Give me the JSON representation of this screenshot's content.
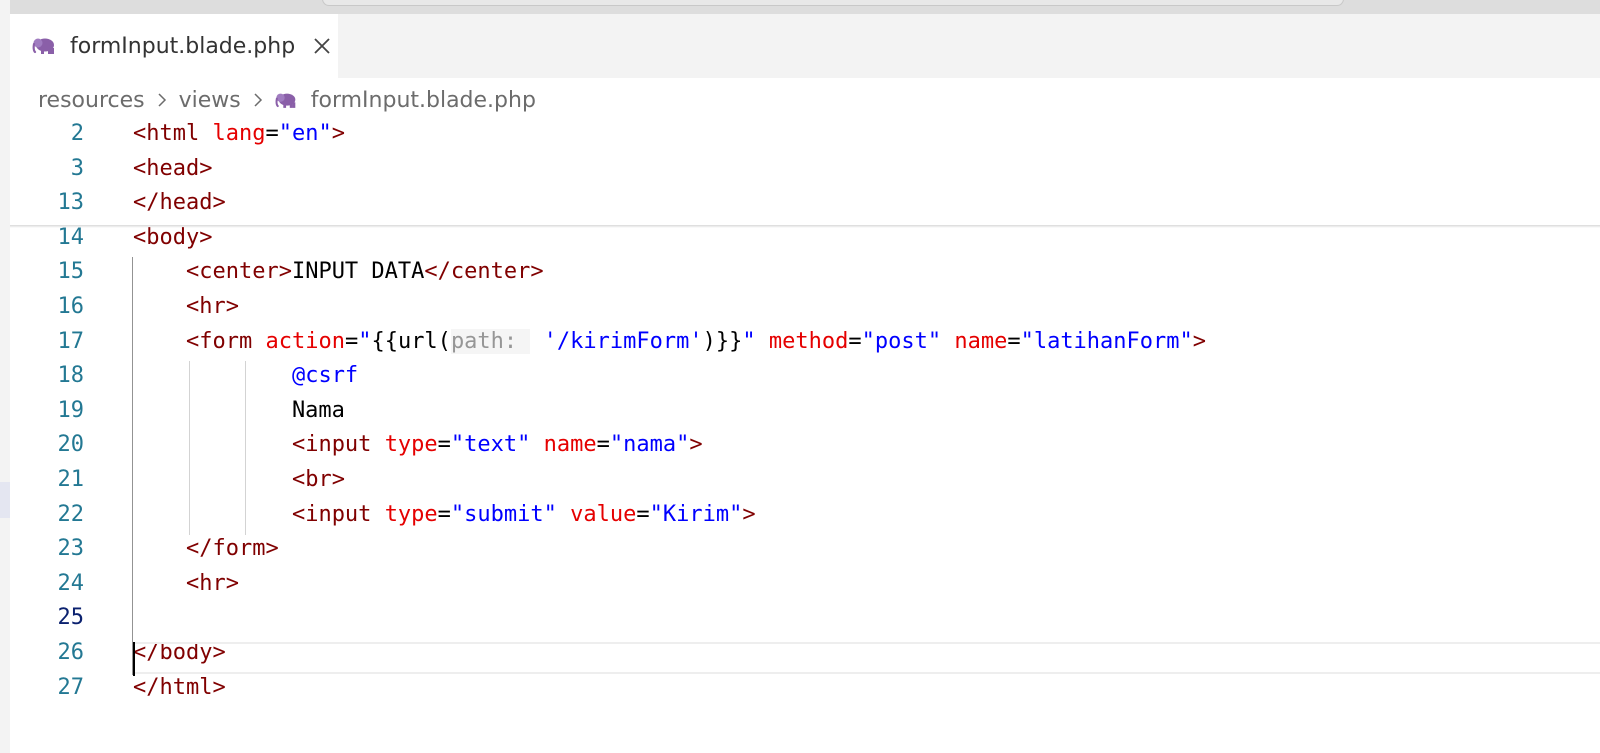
{
  "tab": {
    "label": "formInput.blade.php",
    "icon": "php-elephant-icon"
  },
  "breadcrumb": {
    "items": [
      "resources",
      "views"
    ],
    "file": "formInput.blade.php"
  },
  "colors": {
    "tag": "#800000",
    "attribute": "#e50000",
    "string": "#0000ff",
    "line_number": "#237893",
    "inlay_hint": "#969696"
  },
  "code": {
    "current_line": 25,
    "lines": [
      {
        "n": "2",
        "tokens": [
          [
            "t",
            "<html"
          ],
          [
            "d",
            " "
          ],
          [
            "a",
            "lang"
          ],
          [
            "d",
            "="
          ],
          [
            "s",
            "\"en\""
          ],
          [
            "t",
            ">"
          ]
        ]
      },
      {
        "n": "3",
        "tokens": [
          [
            "t",
            "<head>"
          ]
        ]
      },
      {
        "n": "13",
        "tokens": [
          [
            "t",
            "</head>"
          ]
        ]
      },
      {
        "n": "14",
        "tokens": [
          [
            "t",
            "<body>"
          ]
        ]
      },
      {
        "n": "15",
        "tokens": [
          [
            "d",
            "    "
          ],
          [
            "t",
            "<center>"
          ],
          [
            "d",
            "INPUT DATA"
          ],
          [
            "t",
            "</center>"
          ]
        ]
      },
      {
        "n": "16",
        "tokens": [
          [
            "d",
            "    "
          ],
          [
            "t",
            "<hr>"
          ]
        ]
      },
      {
        "n": "17",
        "tokens": [
          [
            "d",
            "    "
          ],
          [
            "t",
            "<form"
          ],
          [
            "d",
            " "
          ],
          [
            "a",
            "action"
          ],
          [
            "d",
            "="
          ],
          [
            "s",
            "\""
          ],
          [
            "d",
            "{{url("
          ],
          [
            "hint",
            "path: "
          ],
          [
            "d",
            " "
          ],
          [
            "s",
            "'/kirimForm'"
          ],
          [
            "d",
            ")}}"
          ],
          [
            "s",
            "\""
          ],
          [
            "d",
            " "
          ],
          [
            "a",
            "method"
          ],
          [
            "d",
            "="
          ],
          [
            "s",
            "\"post\""
          ],
          [
            "d",
            " "
          ],
          [
            "a",
            "name"
          ],
          [
            "d",
            "="
          ],
          [
            "s",
            "\"latihanForm\""
          ],
          [
            "t",
            ">"
          ]
        ]
      },
      {
        "n": "18",
        "tokens": [
          [
            "d",
            "            "
          ],
          [
            "s",
            "@csrf"
          ]
        ]
      },
      {
        "n": "19",
        "tokens": [
          [
            "d",
            "            Nama"
          ]
        ]
      },
      {
        "n": "20",
        "tokens": [
          [
            "d",
            "            "
          ],
          [
            "t",
            "<input"
          ],
          [
            "d",
            " "
          ],
          [
            "a",
            "type"
          ],
          [
            "d",
            "="
          ],
          [
            "s",
            "\"text\""
          ],
          [
            "d",
            " "
          ],
          [
            "a",
            "name"
          ],
          [
            "d",
            "="
          ],
          [
            "s",
            "\"nama\""
          ],
          [
            "t",
            ">"
          ]
        ]
      },
      {
        "n": "21",
        "tokens": [
          [
            "d",
            "            "
          ],
          [
            "t",
            "<br>"
          ]
        ]
      },
      {
        "n": "22",
        "tokens": [
          [
            "d",
            "            "
          ],
          [
            "t",
            "<input"
          ],
          [
            "d",
            " "
          ],
          [
            "a",
            "type"
          ],
          [
            "d",
            "="
          ],
          [
            "s",
            "\"submit\""
          ],
          [
            "d",
            " "
          ],
          [
            "a",
            "value"
          ],
          [
            "d",
            "="
          ],
          [
            "s",
            "\"Kirim\""
          ],
          [
            "t",
            ">"
          ]
        ]
      },
      {
        "n": "23",
        "tokens": [
          [
            "d",
            "    "
          ],
          [
            "t",
            "</form>"
          ]
        ]
      },
      {
        "n": "24",
        "tokens": [
          [
            "d",
            "    "
          ],
          [
            "t",
            "<hr>"
          ]
        ]
      },
      {
        "n": "25",
        "tokens": []
      },
      {
        "n": "26",
        "tokens": [
          [
            "t",
            "</body>"
          ]
        ]
      },
      {
        "n": "27",
        "tokens": [
          [
            "t",
            "</html>"
          ]
        ]
      }
    ]
  }
}
